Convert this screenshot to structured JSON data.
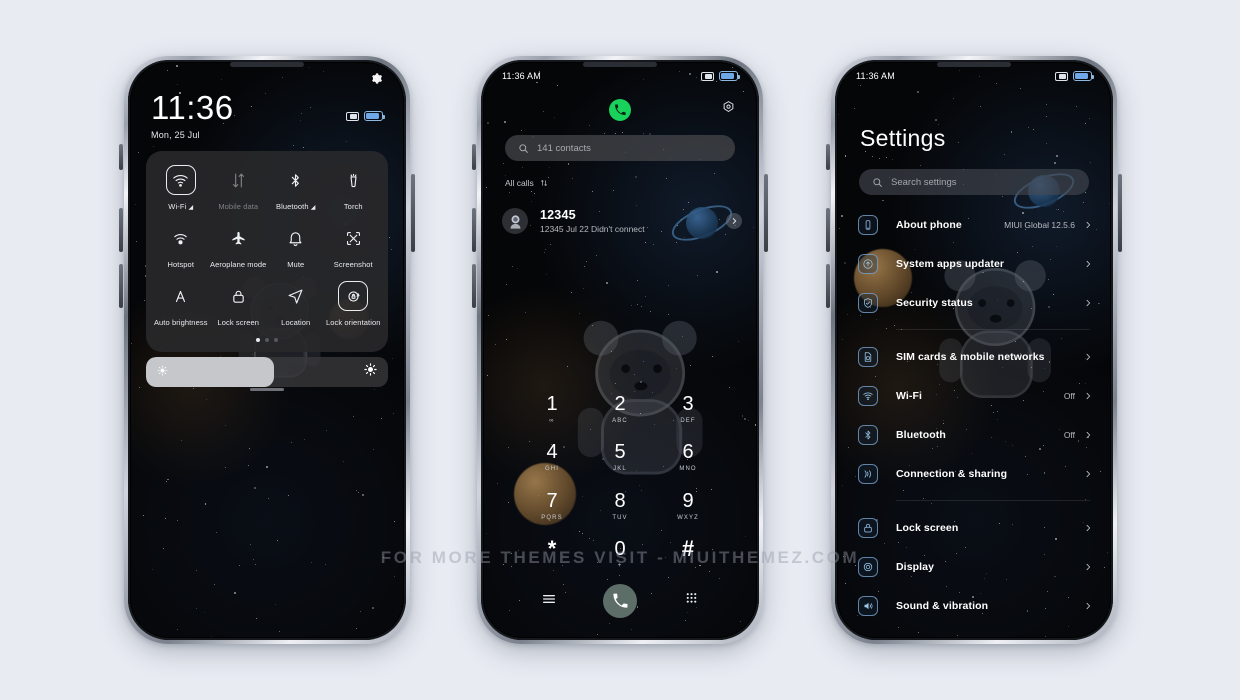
{
  "watermark": "FOR MORE THEMES VISIT - MIUITHEMEZ.COM",
  "colors": {
    "page_bg": "#e8ebf2",
    "accent_blue": "#6fa8e8",
    "call_green": "#19d25c",
    "panel": "#282829"
  },
  "phone1": {
    "status": {
      "battery_icon": "battery-icon",
      "sd_icon": "sd-card-icon"
    },
    "clock": "11:36",
    "date": "Mon, 25 Jul",
    "gear_icon": "gear-icon",
    "tiles": [
      {
        "label": "Wi-Fi",
        "icon": "wifi-icon",
        "active": true,
        "dim": false,
        "arrow": true
      },
      {
        "label": "Mobile data",
        "icon": "mobile-data-icon",
        "active": false,
        "dim": true,
        "arrow": false
      },
      {
        "label": "Bluetooth",
        "icon": "bluetooth-icon",
        "active": false,
        "dim": false,
        "arrow": true
      },
      {
        "label": "Torch",
        "icon": "torch-icon",
        "active": false,
        "dim": false,
        "arrow": false
      },
      {
        "label": "Hotspot",
        "icon": "hotspot-icon",
        "active": false,
        "dim": false,
        "arrow": false
      },
      {
        "label": "Aeroplane mode",
        "icon": "aeroplane-icon",
        "active": false,
        "dim": false,
        "arrow": false
      },
      {
        "label": "Mute",
        "icon": "bell-icon",
        "active": false,
        "dim": false,
        "arrow": false
      },
      {
        "label": "Screenshot",
        "icon": "screenshot-icon",
        "active": false,
        "dim": false,
        "arrow": false
      },
      {
        "label": "Auto brightness",
        "icon": "auto-brightness-icon",
        "active": false,
        "dim": false,
        "arrow": false
      },
      {
        "label": "Lock screen",
        "icon": "lock-icon",
        "active": false,
        "dim": false,
        "arrow": false
      },
      {
        "label": "Location",
        "icon": "location-icon",
        "active": false,
        "dim": false,
        "arrow": false
      },
      {
        "label": "Lock orientation",
        "icon": "rotation-lock-icon",
        "active": true,
        "dim": false,
        "arrow": false
      }
    ],
    "page_dots": {
      "count": 3,
      "active_index": 0
    },
    "brightness": {
      "percent": 53,
      "low_icon": "brightness-low-icon",
      "high_icon": "brightness-high-icon"
    }
  },
  "phone2": {
    "status": {
      "time": "11:36 AM"
    },
    "phone_icon": "phone-handset-icon",
    "settings_icon": "dialer-settings-icon",
    "search": {
      "placeholder": "141 contacts",
      "icon": "search-icon"
    },
    "filter": {
      "label": "All calls",
      "icon": "sort-icon"
    },
    "call_log": [
      {
        "name": "12345",
        "detail": "12345  Jul 22  Didn't connect",
        "avatar_icon": "astronaut-avatar-icon",
        "chevron_icon": "chevron-right-icon"
      }
    ],
    "keypad": [
      {
        "digit": "1",
        "letters": "∞"
      },
      {
        "digit": "2",
        "letters": "ABC"
      },
      {
        "digit": "3",
        "letters": "DEF"
      },
      {
        "digit": "4",
        "letters": "GHI"
      },
      {
        "digit": "5",
        "letters": "JKL"
      },
      {
        "digit": "6",
        "letters": "MNO"
      },
      {
        "digit": "7",
        "letters": "PQRS"
      },
      {
        "digit": "8",
        "letters": "TUV"
      },
      {
        "digit": "9",
        "letters": "WXYZ"
      },
      {
        "digit": "*",
        "letters": ""
      },
      {
        "digit": "0",
        "letters": "+"
      },
      {
        "digit": "#",
        "letters": ""
      }
    ],
    "bottom_bar": {
      "menu_icon": "menu-icon",
      "call_icon": "call-button-icon",
      "keypad_icon": "keypad-icon"
    }
  },
  "phone3": {
    "status": {
      "time": "11:36 AM"
    },
    "title": "Settings",
    "search": {
      "placeholder": "Search settings",
      "icon": "search-icon"
    },
    "groups": [
      {
        "items": [
          {
            "label": "About phone",
            "value": "MIUI Global 12.5.6",
            "icon": "about-phone-icon"
          },
          {
            "label": "System apps updater",
            "value": "",
            "icon": "updater-icon"
          },
          {
            "label": "Security status",
            "value": "",
            "icon": "security-icon"
          }
        ]
      },
      {
        "items": [
          {
            "label": "SIM cards & mobile networks",
            "value": "",
            "icon": "sim-card-icon"
          },
          {
            "label": "Wi-Fi",
            "value": "Off",
            "icon": "wifi-icon"
          },
          {
            "label": "Bluetooth",
            "value": "Off",
            "icon": "bluetooth-icon"
          },
          {
            "label": "Connection & sharing",
            "value": "",
            "icon": "connection-sharing-icon"
          }
        ]
      },
      {
        "items": [
          {
            "label": "Lock screen",
            "value": "",
            "icon": "lock-icon"
          },
          {
            "label": "Display",
            "value": "",
            "icon": "display-icon"
          },
          {
            "label": "Sound & vibration",
            "value": "",
            "icon": "sound-icon"
          }
        ]
      }
    ]
  }
}
